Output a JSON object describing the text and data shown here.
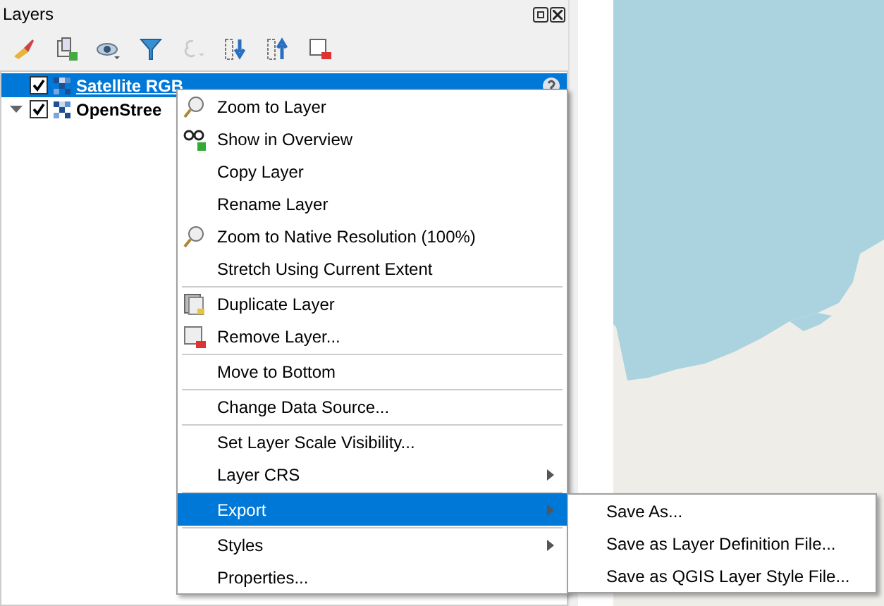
{
  "panel": {
    "title": "Layers"
  },
  "toolbar": [
    {
      "disabled": false
    },
    {
      "disabled": false
    },
    {
      "disabled": false
    },
    {
      "disabled": false
    },
    {
      "disabled": true
    },
    {
      "disabled": false
    },
    {
      "disabled": false
    },
    {
      "disabled": false
    }
  ],
  "layers": [
    {
      "name": "Satellite RGB",
      "checked": true,
      "selected": true,
      "expanded": false
    },
    {
      "name": "OpenStree",
      "checked": true,
      "selected": false,
      "expanded": true
    }
  ],
  "context_menu": [
    {
      "kind": "item",
      "label": "Zoom to Layer"
    },
    {
      "kind": "item",
      "label": "Show in Overview"
    },
    {
      "kind": "item",
      "label": "Copy Layer"
    },
    {
      "kind": "item",
      "label": "Rename Layer"
    },
    {
      "kind": "item",
      "label": "Zoom to Native Resolution (100%)"
    },
    {
      "kind": "item",
      "label": "Stretch Using Current Extent"
    },
    {
      "kind": "separator"
    },
    {
      "kind": "item",
      "label": "Duplicate Layer"
    },
    {
      "kind": "item",
      "label": "Remove Layer..."
    },
    {
      "kind": "separator"
    },
    {
      "kind": "item",
      "label": "Move to Bottom"
    },
    {
      "kind": "separator"
    },
    {
      "kind": "item",
      "label": "Change Data Source..."
    },
    {
      "kind": "separator"
    },
    {
      "kind": "item",
      "label": "Set Layer Scale Visibility..."
    },
    {
      "kind": "submenu",
      "label": "Layer CRS",
      "selected": false
    },
    {
      "kind": "separator"
    },
    {
      "kind": "submenu",
      "label": "Export",
      "selected": true
    },
    {
      "kind": "separator"
    },
    {
      "kind": "submenu",
      "label": "Styles",
      "selected": false
    },
    {
      "kind": "item",
      "label": "Properties..."
    }
  ],
  "submenu": [
    {
      "label": "Save As..."
    },
    {
      "label": "Save as Layer Definition File..."
    },
    {
      "label": "Save as QGIS Layer Style File..."
    }
  ]
}
